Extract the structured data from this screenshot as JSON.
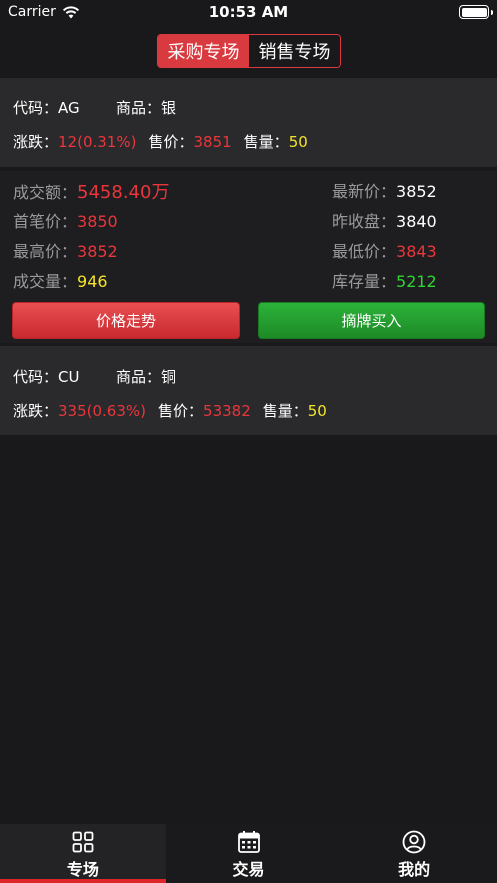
{
  "status": {
    "carrier": "Carrier",
    "time": "10:53 AM"
  },
  "segment": {
    "items": [
      "采购专场",
      "销售专场"
    ],
    "active": 0
  },
  "card1": {
    "code_label": "代码：",
    "code": "AG",
    "product_label": "商品：",
    "product": "银",
    "change_label": "涨跌：",
    "change": "12(0.31%)",
    "price_label": "售价：",
    "price": "3851",
    "volume_label": "售量：",
    "volume": "50"
  },
  "detail": {
    "turnover_label": "成交额：",
    "turnover": "5458.40万",
    "first_label": "首笔价：",
    "first": "3850",
    "high_label": "最高价：",
    "high": "3852",
    "deal_label": "成交量：",
    "deal": "946",
    "latest_label": "最新价：",
    "latest": "3852",
    "prev_close_label": "昨收盘：",
    "prev_close": "3840",
    "low_label": "最低价：",
    "low": "3843",
    "stock_label": "库存量：",
    "stock": "5212"
  },
  "buttons": {
    "trend": "价格走势",
    "buy": "摘牌买入"
  },
  "card2": {
    "code_label": "代码：",
    "code": "CU",
    "product_label": "商品：",
    "product": "铜",
    "change_label": "涨跌：",
    "change": "335(0.63%)",
    "price_label": "售价：",
    "price": "53382",
    "volume_label": "售量：",
    "volume": "50"
  },
  "tabbar": {
    "items": [
      "专场",
      "交易",
      "我的"
    ],
    "active": 0
  },
  "colors": {
    "accent_red": "#e8363c",
    "accent_green": "#2bd632",
    "accent_yellow": "#f5e42a",
    "background": "#19191b"
  },
  "icons": [
    "wifi-icon",
    "battery-icon",
    "grid-icon",
    "calendar-icon",
    "user-icon"
  ]
}
